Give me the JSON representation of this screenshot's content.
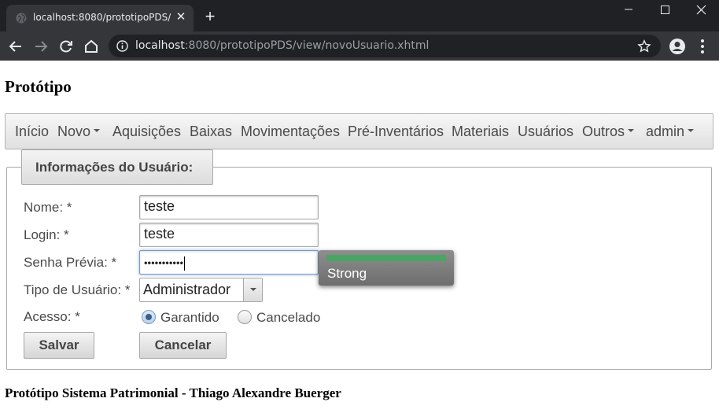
{
  "browser": {
    "tab_title": "localhost:8080/prototipoPDS/view/novoUsuario.xhtml",
    "new_tab": "+",
    "tab_close": "✕",
    "url_host": "localhost",
    "url_rest": ":8080/prototipoPDS/view/novoUsuario.xhtml",
    "chrome_colors": {
      "titlebar": "#202124",
      "toolbar": "#35363a"
    }
  },
  "page": {
    "title": "Protótipo",
    "footer": "Protótipo Sistema Patrimonial - Thiago Alexandre Buerger"
  },
  "menu": {
    "inicio": "Início",
    "novo": "Novo",
    "aquisicoes": "Aquisições",
    "baixas": "Baixas",
    "movimentacoes": "Movimentações",
    "pre_inventarios": "Pré-Inventários",
    "materiais": "Materiais",
    "usuarios": "Usuários",
    "outros": "Outros",
    "admin": "admin"
  },
  "form": {
    "legend": "Informações do Usuário:",
    "nome_label": "Nome: *",
    "nome_value": "teste",
    "login_label": "Login: *",
    "login_value": "teste",
    "senha_label": "Senha Prévia: *",
    "senha_value": "•••••••••••",
    "tipo_label": "Tipo de Usuário: *",
    "tipo_value": "Administrador",
    "acesso_label": "Acesso: *",
    "acesso_options": [
      "Garantido",
      "Cancelado"
    ],
    "acesso_selected": "Garantido",
    "salvar": "Salvar",
    "cancelar": "Cancelar"
  },
  "password_strength": {
    "label": "Strong",
    "level": 1.0,
    "color": "#4aa564"
  }
}
